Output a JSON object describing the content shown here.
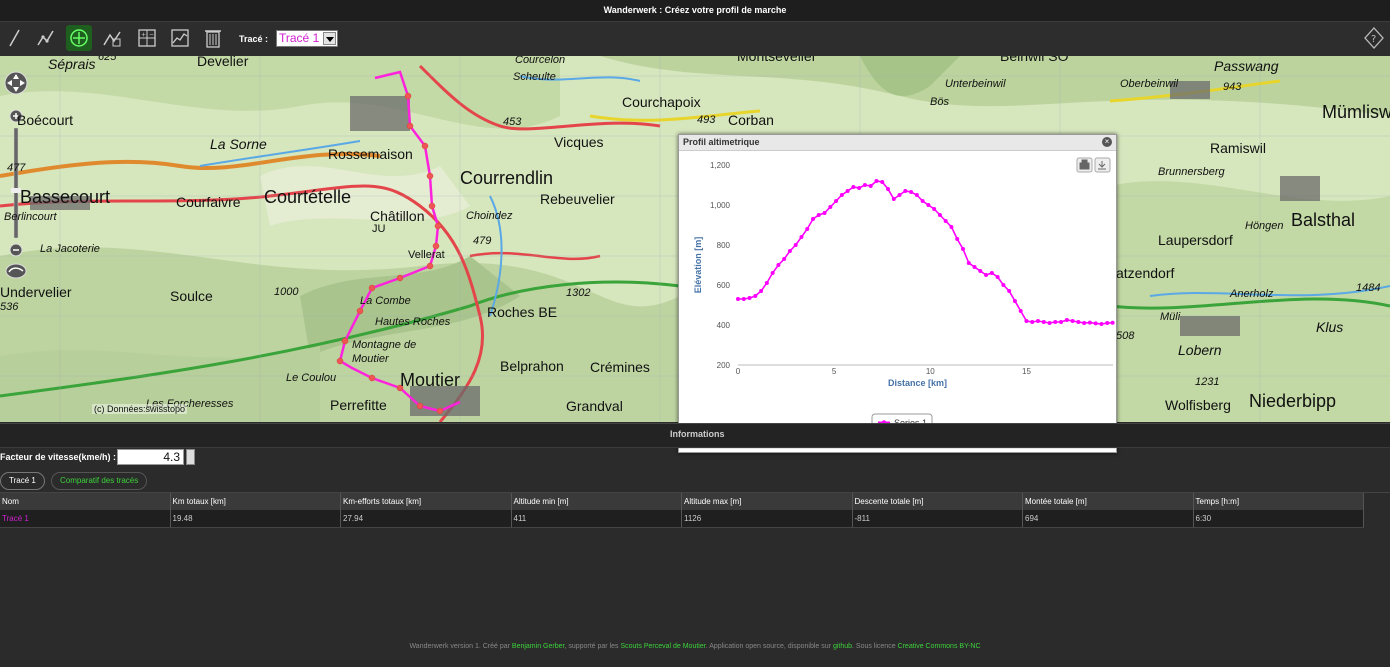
{
  "window": {
    "title": "Wanderwerk : Créez votre profil de marche"
  },
  "toolbar": {
    "tools": [
      {
        "name": "draw-pencil-icon"
      },
      {
        "name": "draw-route-icon"
      },
      {
        "name": "add-point-icon"
      },
      {
        "name": "edit-route-icon"
      },
      {
        "name": "calculator-icon"
      },
      {
        "name": "profile-chart-icon"
      },
      {
        "name": "trash-icon"
      }
    ],
    "trace_label": "Tracé :",
    "trace_selected": "Tracé 1",
    "help_icon": "help-icon"
  },
  "map": {
    "attribution": "(c) Données:swisstopo",
    "places": [
      {
        "t": "Séprais",
        "cls": "med it"
      },
      {
        "t": "625",
        "cls": "num"
      },
      {
        "t": "Develier",
        "cls": "med"
      },
      {
        "t": "Boécourt",
        "cls": "med"
      },
      {
        "t": "La Sorne",
        "cls": "med it"
      },
      {
        "t": "Rossemaison",
        "cls": "med"
      },
      {
        "t": "Courcelon",
        "cls": "small it"
      },
      {
        "t": "Scheulte",
        "cls": "small it"
      },
      {
        "t": "Courchapoix",
        "cls": "med"
      },
      {
        "t": "493",
        "cls": "num"
      },
      {
        "t": "Corban",
        "cls": "med"
      },
      {
        "t": "453",
        "cls": "num"
      },
      {
        "t": "Vicques",
        "cls": "med"
      },
      {
        "t": "Montsevelier",
        "cls": "med"
      },
      {
        "t": "Beinwil SO",
        "cls": "med"
      },
      {
        "t": "Bös",
        "cls": "small it"
      },
      {
        "t": "Unterbeinwil",
        "cls": "small it"
      },
      {
        "t": "Oberbeinwil",
        "cls": "small it"
      },
      {
        "t": "943",
        "cls": "num"
      },
      {
        "t": "Passwang",
        "cls": "med it"
      },
      {
        "t": "Mümlisw",
        "cls": "big"
      },
      {
        "t": "Ramiswil",
        "cls": "med"
      },
      {
        "t": "477",
        "cls": "num"
      },
      {
        "t": "Bassecourt",
        "cls": "big"
      },
      {
        "t": "Courfaivre",
        "cls": "med"
      },
      {
        "t": "Courtételle",
        "cls": "big"
      },
      {
        "t": "Courrendlin",
        "cls": "big"
      },
      {
        "t": "Rebeuvelier",
        "cls": "med"
      },
      {
        "t": "Berlincourt",
        "cls": "small it"
      },
      {
        "t": "Châtillon",
        "cls": "med"
      },
      {
        "t": "JU",
        "cls": "small"
      },
      {
        "t": "Choindez",
        "cls": "small it"
      },
      {
        "t": "479",
        "cls": "num"
      },
      {
        "t": "La Jacoterie",
        "cls": "small it"
      },
      {
        "t": "Vellerat",
        "cls": "small"
      },
      {
        "t": "Brunnersberg",
        "cls": "small it"
      },
      {
        "t": "Höngen",
        "cls": "small it"
      },
      {
        "t": "Balsthal",
        "cls": "big"
      },
      {
        "t": "Laupersdorf",
        "cls": "med"
      },
      {
        "t": "atzendorf",
        "cls": "med"
      },
      {
        "t": "Undervelier",
        "cls": "med"
      },
      {
        "t": "536",
        "cls": "num"
      },
      {
        "t": "Soulce",
        "cls": "med"
      },
      {
        "t": "1000",
        "cls": "num"
      },
      {
        "t": "La Combe",
        "cls": "small it"
      },
      {
        "t": "1302",
        "cls": "num"
      },
      {
        "t": "Hautes Roches",
        "cls": "small it"
      },
      {
        "t": "Roches BE",
        "cls": "med"
      },
      {
        "t": "Montagne de",
        "cls": "small it"
      },
      {
        "t": "Moutier",
        "cls": "small it"
      },
      {
        "t": "Belprahon",
        "cls": "med"
      },
      {
        "t": "Crémines",
        "cls": "med"
      },
      {
        "t": "Le Coulou",
        "cls": "small it"
      },
      {
        "t": "Moutier",
        "cls": "big"
      },
      {
        "t": "Les Forcheresses",
        "cls": "small it"
      },
      {
        "t": "Perrefitte",
        "cls": "med"
      },
      {
        "t": "Grandval",
        "cls": "med"
      },
      {
        "t": "Anerholz",
        "cls": "small it"
      },
      {
        "t": "Müli",
        "cls": "small it"
      },
      {
        "t": "Klus",
        "cls": "med it"
      },
      {
        "t": "1484",
        "cls": "num"
      },
      {
        "t": "508",
        "cls": "num"
      },
      {
        "t": "1231",
        "cls": "num"
      },
      {
        "t": "Wolfisberg",
        "cls": "med"
      },
      {
        "t": "Niederbipp",
        "cls": "big"
      },
      {
        "t": "Lobern",
        "cls": "med it"
      }
    ]
  },
  "profile": {
    "title": "Profil altimetrique",
    "buttons": [
      "print-icon",
      "download-icon"
    ]
  },
  "chart_data": {
    "type": "line",
    "title": "",
    "xlabel": "Distance [km]",
    "ylabel": "Elévation [m]",
    "xlim": [
      0,
      19.5
    ],
    "ylim": [
      200,
      1200
    ],
    "xticks": [
      0,
      5,
      10,
      15
    ],
    "yticks": [
      "1,200",
      "1,000",
      "800",
      "600",
      "400",
      "200"
    ],
    "ytick_values": [
      1200,
      1000,
      800,
      600,
      400,
      200
    ],
    "grid": false,
    "legend": "bottom",
    "series": [
      {
        "name": "Series 1",
        "color": "#ff00ff",
        "x": [
          0,
          0.3,
          0.6,
          0.9,
          1.2,
          1.5,
          1.8,
          2.1,
          2.4,
          2.7,
          3.0,
          3.3,
          3.6,
          3.9,
          4.2,
          4.5,
          4.8,
          5.1,
          5.4,
          5.7,
          6.0,
          6.3,
          6.6,
          6.9,
          7.2,
          7.5,
          7.8,
          8.1,
          8.4,
          8.7,
          9.0,
          9.3,
          9.6,
          9.9,
          10.2,
          10.5,
          10.8,
          11.1,
          11.4,
          11.7,
          12.0,
          12.3,
          12.6,
          12.9,
          13.2,
          13.5,
          13.8,
          14.1,
          14.4,
          14.7,
          15.0,
          15.3,
          15.6,
          15.9,
          16.2,
          16.5,
          16.8,
          17.1,
          17.4,
          17.7,
          18.0,
          18.3,
          18.6,
          18.9,
          19.2,
          19.48
        ],
        "y": [
          530,
          530,
          535,
          545,
          570,
          610,
          660,
          700,
          730,
          770,
          800,
          840,
          880,
          930,
          950,
          960,
          990,
          1020,
          1050,
          1070,
          1090,
          1085,
          1100,
          1095,
          1120,
          1115,
          1080,
          1030,
          1050,
          1070,
          1065,
          1050,
          1020,
          1000,
          980,
          950,
          920,
          890,
          830,
          780,
          710,
          690,
          670,
          650,
          660,
          640,
          600,
          570,
          520,
          470,
          420,
          415,
          420,
          415,
          410,
          415,
          415,
          425,
          420,
          415,
          410,
          412,
          408,
          405,
          410,
          411
        ]
      }
    ]
  },
  "info": {
    "label": "Informations",
    "speed_label": "Facteur de vitesse(kme/h) :",
    "speed_value": "4.3",
    "tabs": [
      "Tracé 1",
      "Comparatif des tracés"
    ],
    "table": {
      "headers": [
        "Nom",
        "Km totaux [km]",
        "Km-efforts totaux [km]",
        "Altitude min [m]",
        "Altitude max [m]",
        "Descente totale [m]",
        "Montée totale [m]",
        "Temps [h:m]"
      ],
      "rows": [
        [
          "Tracé 1",
          "19.48",
          "27.94",
          "411",
          "1126",
          "-811",
          "694",
          "6:30"
        ]
      ]
    }
  },
  "footer": {
    "p1": "Wanderwerk version 1. Créé par ",
    "link1": "Benjamin Gerber",
    "p2": ", supporté par les ",
    "link2": "Scouts Perceval de Moutier",
    "p3": ". Application open source, disponible sur ",
    "link3": "github",
    "p4": ". Sous licence ",
    "link4": "Creative Commons BY-NC"
  }
}
